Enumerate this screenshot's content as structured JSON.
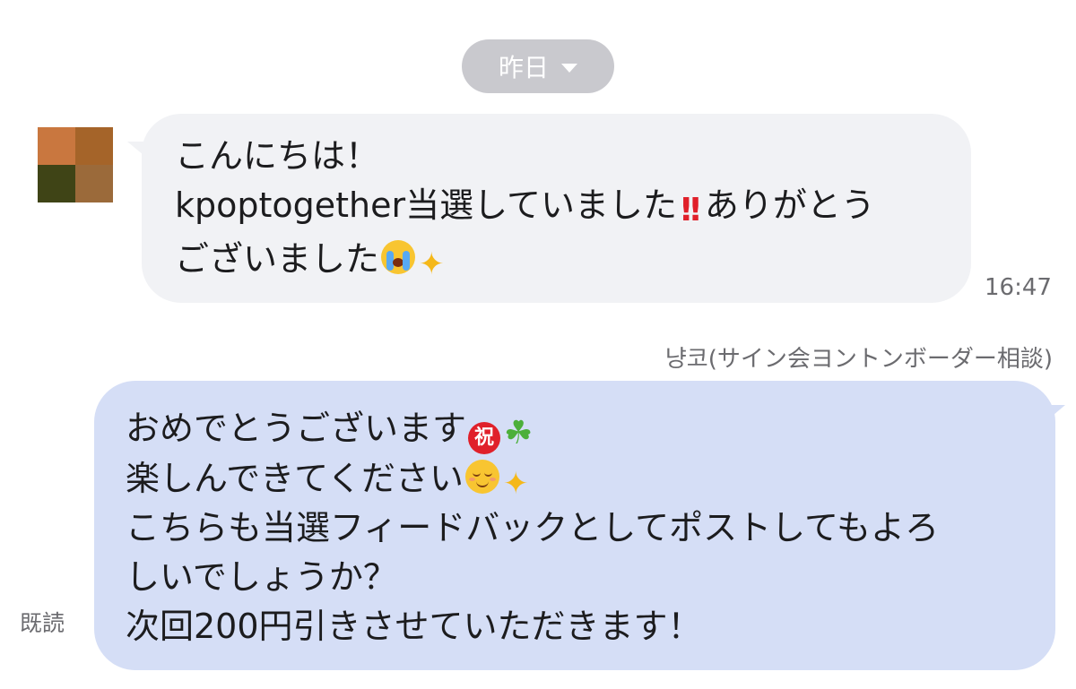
{
  "date_divider": {
    "label": "昨日",
    "icon": "chevron-down-icon"
  },
  "incoming": {
    "time": "16:47",
    "lines": [
      {
        "text": "こんにちは！"
      },
      {
        "text": "kpoptogether当選していました",
        "emoji1": "‼️",
        "text2": "ありがとう"
      },
      {
        "text": "ございました",
        "emoji1": "😭",
        "emoji2": "✨"
      }
    ]
  },
  "outgoing": {
    "sender": "냥코(サイン会ヨントンボーダー相談)",
    "read_status": "既読",
    "lines": [
      {
        "text": "おめでとうございます",
        "emoji1": "㊗️",
        "emoji2": "☘️"
      },
      {
        "text": "楽しんできてください",
        "emoji1": "☺️",
        "emoji2": "✨"
      },
      {
        "text": "こちらも当選フィードバックとしてポストしてもよろ"
      },
      {
        "text": "しいでしょうか？"
      },
      {
        "text": "次回200円引きさせていただきます！"
      }
    ]
  },
  "colors": {
    "incoming_bubble": "#f1f2f5",
    "outgoing_bubble": "#d5def6",
    "date_pill": "#c9c9ce",
    "meta_text": "#6b6b6f"
  }
}
